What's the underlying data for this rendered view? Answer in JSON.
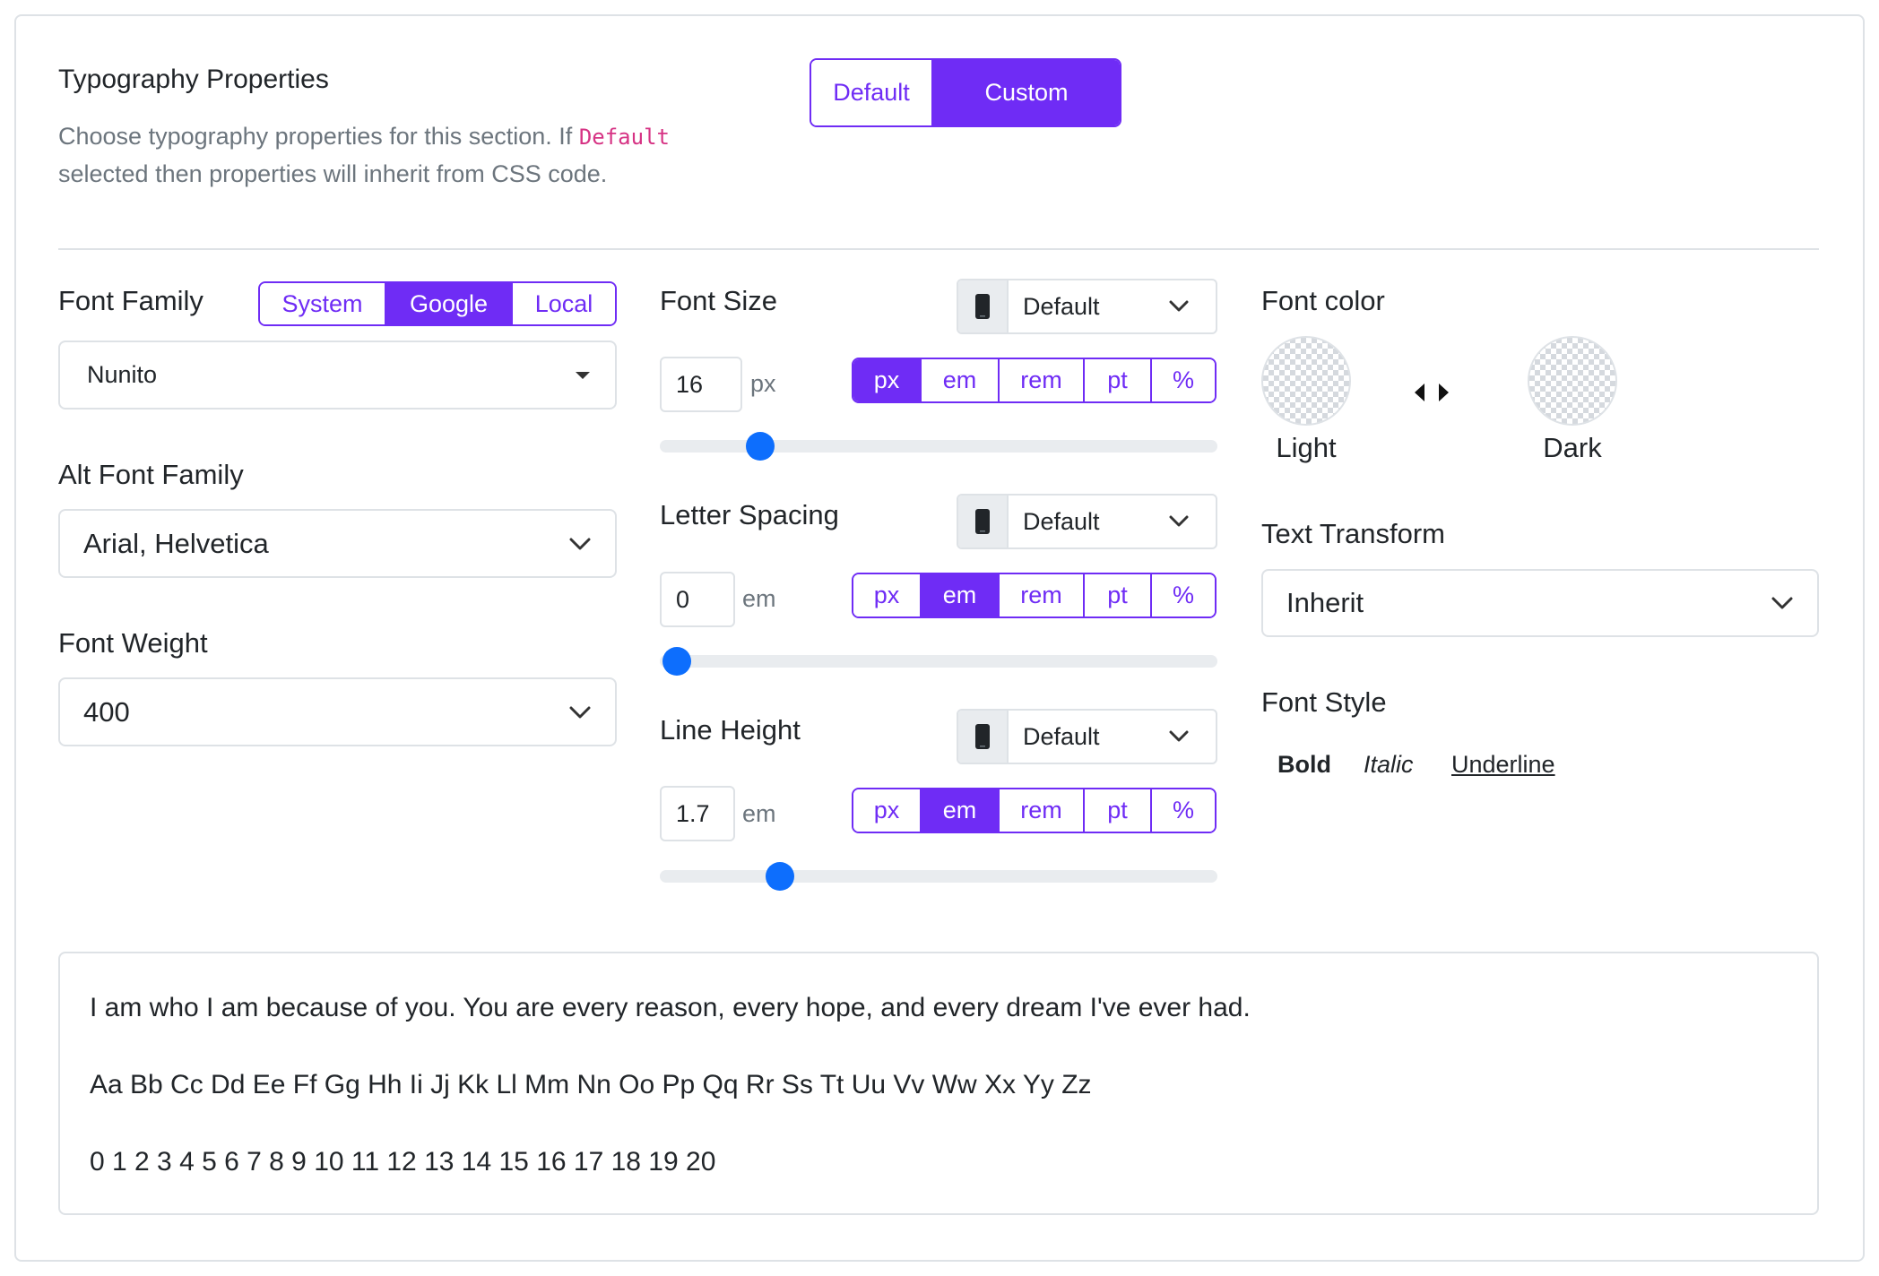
{
  "header": {
    "title": "Typography Properties",
    "description_prefix": "Choose typography properties for this section. If",
    "description_code": "Default",
    "description_suffix": "selected then properties will inherit from CSS code.",
    "mode_options": [
      "Default",
      "Custom"
    ],
    "mode_selected": "Custom"
  },
  "font_family": {
    "label": "Font Family",
    "source_options": [
      "System",
      "Google",
      "Local"
    ],
    "source_selected": "Google",
    "value": "Nunito"
  },
  "alt_font_family": {
    "label": "Alt Font Family",
    "value": "Arial, Helvetica"
  },
  "font_weight": {
    "label": "Font Weight",
    "value": "400"
  },
  "font_size": {
    "label": "Font Size",
    "device_value": "Default",
    "value": "16",
    "unit_label": "px",
    "units": [
      "px",
      "em",
      "rem",
      "pt",
      "%"
    ],
    "unit_selected": "px",
    "slider_fraction": 0.18
  },
  "letter_spacing": {
    "label": "Letter Spacing",
    "device_value": "Default",
    "value": "0",
    "unit_label": "em",
    "units": [
      "px",
      "em",
      "rem",
      "pt",
      "%"
    ],
    "unit_selected": "em",
    "slider_fraction": 0.03
  },
  "line_height": {
    "label": "Line Height",
    "device_value": "Default",
    "value": "1.7",
    "unit_label": "em",
    "units": [
      "px",
      "em",
      "rem",
      "pt",
      "%"
    ],
    "unit_selected": "em",
    "slider_fraction": 0.215
  },
  "font_color": {
    "label": "Font color",
    "light_label": "Light",
    "dark_label": "Dark"
  },
  "text_transform": {
    "label": "Text Transform",
    "value": "Inherit"
  },
  "font_style": {
    "label": "Font Style",
    "bold": "Bold",
    "italic": "Italic",
    "underline": "Underline"
  },
  "preview": {
    "line1": "I am who I am because of you. You are every reason, every hope, and every dream I've ever had.",
    "line2": "Aa Bb Cc Dd Ee Ff Gg Hh Ii Jj Kk Ll Mm Nn Oo Pp Qq Rr Ss Tt Uu Vv Ww Xx Yy Zz",
    "line3": "0 1 2 3 4 5 6 7 8 9 10 11 12 13 14 15 16 17 18 19 20"
  },
  "colors": {
    "accent": "#6f2cf5",
    "slider_thumb": "#0d6efd",
    "code": "#d63384"
  },
  "icons": {
    "device": "mobile-phone-icon",
    "chevron": "chevron-down-icon",
    "caret": "caret-down-icon",
    "arrows": "left-right-arrows-icon"
  }
}
